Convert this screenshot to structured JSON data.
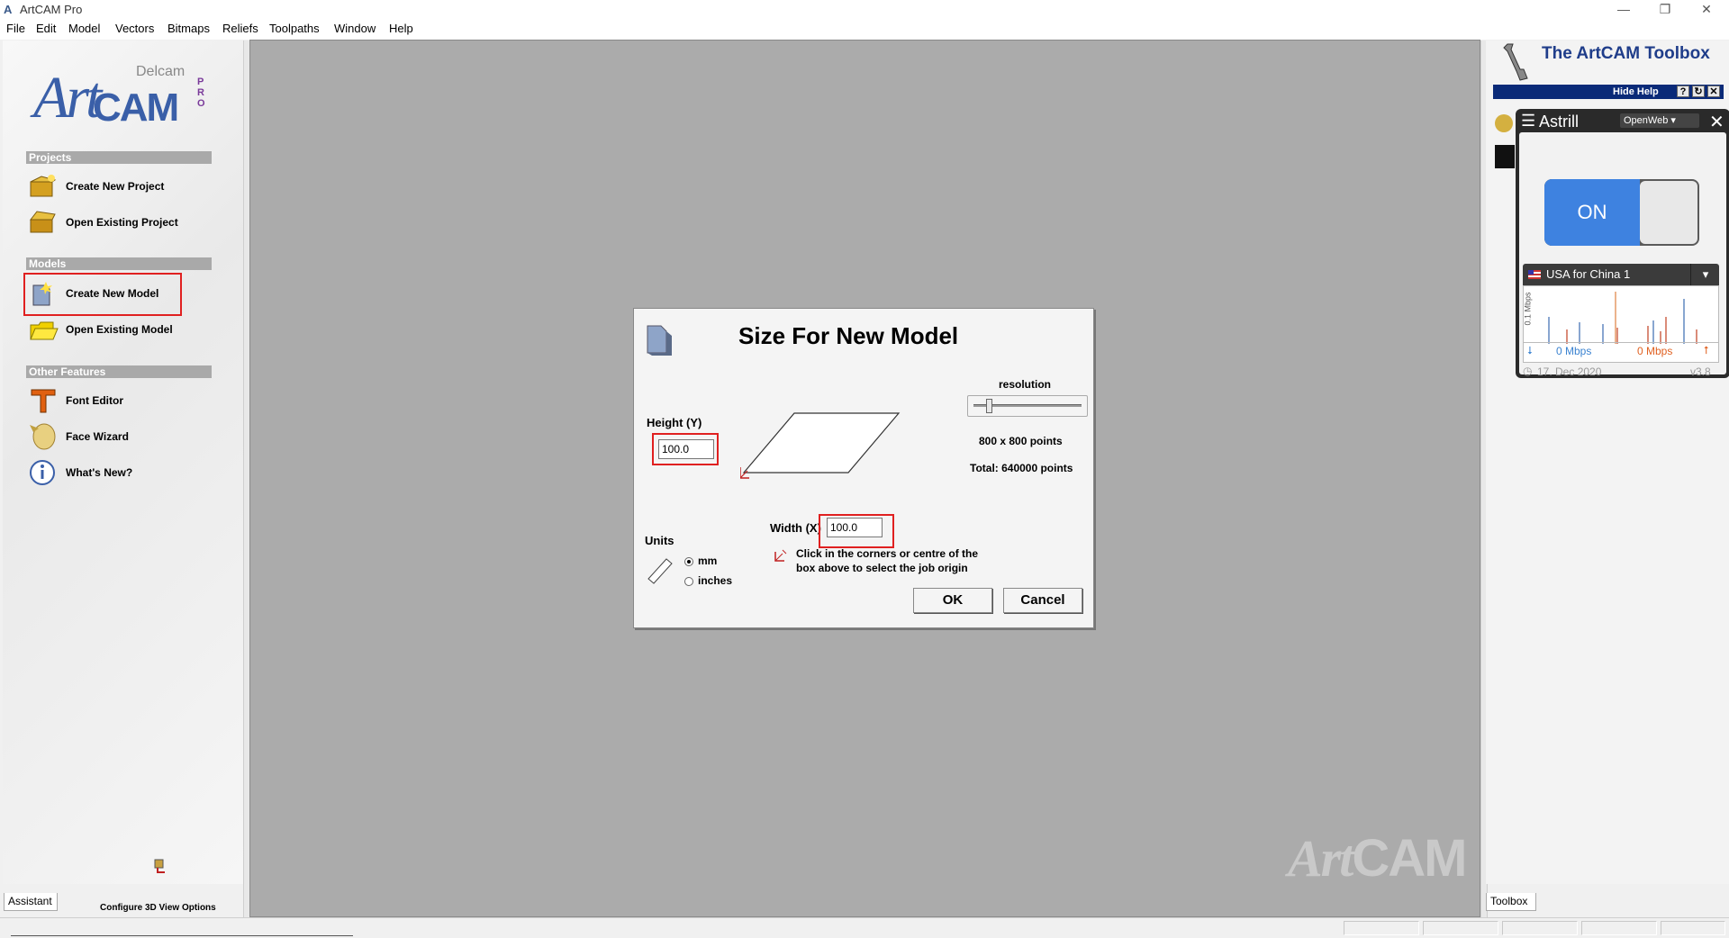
{
  "window": {
    "title": "ArtCAM Pro",
    "minimize": "—",
    "restore": "❐",
    "close": "✕"
  },
  "menubar": {
    "items": [
      "File",
      "Edit",
      "Model",
      "Vectors",
      "Bitmaps",
      "Reliefs",
      "Toolpaths",
      "Window",
      "Help"
    ]
  },
  "assistant": {
    "logo_brand": "Delcam",
    "logo_art": "Art",
    "logo_cam": "CAM",
    "logo_pro": "PRO",
    "sections": [
      {
        "title": "Projects",
        "items": [
          {
            "label": "Create New Project",
            "icon": "create-project-icon"
          },
          {
            "label": "Open Existing Project",
            "icon": "open-project-icon"
          }
        ]
      },
      {
        "title": "Models",
        "items": [
          {
            "label": "Create New Model",
            "icon": "create-model-icon"
          },
          {
            "label": "Open Existing Model",
            "icon": "open-model-icon"
          }
        ]
      },
      {
        "title": "Other Features",
        "items": [
          {
            "label": "Font Editor",
            "icon": "font-editor-icon"
          },
          {
            "label": "Face Wizard",
            "icon": "face-wizard-icon"
          },
          {
            "label": "What's New?",
            "icon": "info-icon"
          }
        ]
      }
    ],
    "configure_label": "Configure 3D View Options",
    "tab_label": "Assistant"
  },
  "workspace": {
    "watermark_art": "Art",
    "watermark_cam": "CAM"
  },
  "dialog": {
    "title": "Size For New Model",
    "height_label": "Height (Y)",
    "height_value": "100.0",
    "width_label": "Width (X)",
    "width_value": "100.0",
    "resolution_label": "resolution",
    "points_text": "800 x 800 points",
    "total_text": "Total: 640000 points",
    "units_label": "Units",
    "unit_mm": "mm",
    "unit_inches": "inches",
    "selected_unit": "mm",
    "origin_hint_line1": "Click in the corners or centre of the",
    "origin_hint_line2": "box above to select the job origin",
    "ok_label": "OK",
    "cancel_label": "Cancel"
  },
  "toolbox": {
    "title": "The ArtCAM Toolbox",
    "hide_help_label": "Hide Help",
    "help_btn": "?",
    "refresh_btn": "↻",
    "close_btn": "✕",
    "tab_label": "Toolbox"
  },
  "astrill": {
    "brand": "Astrill",
    "mode": "OpenWeb",
    "toggle_label": "ON",
    "server": "USA for China 1",
    "graph_axis": "0.1 Mbps",
    "download_rate": "0 Mbps",
    "upload_rate": "0 Mbps",
    "date": "17. Dec 2020",
    "version": "v3.8",
    "accent": "#3e82e0"
  }
}
